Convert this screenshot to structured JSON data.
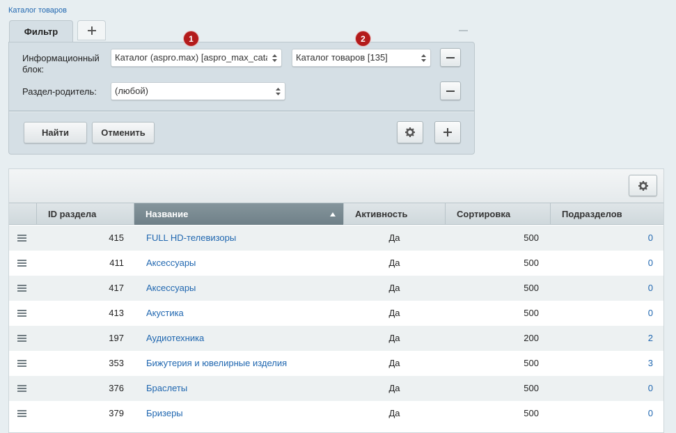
{
  "breadcrumb": "Каталог товаров",
  "filter": {
    "tab_label": "Фильтр",
    "iblock_label": "Информационный блок:",
    "iblock_select": "Каталог (aspro.max) [aspro_max_catalog]",
    "iblock_type_select": "Каталог товаров [135]",
    "section_label": "Раздел-родитель:",
    "section_select": "(любой)",
    "badge1": "1",
    "badge2": "2",
    "find_button": "Найти",
    "cancel_button": "Отменить"
  },
  "grid": {
    "columns": {
      "id": "ID раздела",
      "name": "Название",
      "active": "Активность",
      "sort": "Сортировка",
      "subsections": "Подразделов"
    },
    "rows": [
      {
        "id": "415",
        "name": "FULL HD-телевизоры",
        "active": "Да",
        "sort": "500",
        "subsections": "0"
      },
      {
        "id": "411",
        "name": "Аксессуары",
        "active": "Да",
        "sort": "500",
        "subsections": "0"
      },
      {
        "id": "417",
        "name": "Аксессуары",
        "active": "Да",
        "sort": "500",
        "subsections": "0"
      },
      {
        "id": "413",
        "name": "Акустика",
        "active": "Да",
        "sort": "500",
        "subsections": "0"
      },
      {
        "id": "197",
        "name": "Аудиотехника",
        "active": "Да",
        "sort": "200",
        "subsections": "2"
      },
      {
        "id": "353",
        "name": "Бижутерия и ювелирные изделия",
        "active": "Да",
        "sort": "500",
        "subsections": "3"
      },
      {
        "id": "376",
        "name": "Браслеты",
        "active": "Да",
        "sort": "500",
        "subsections": "0"
      },
      {
        "id": "379",
        "name": "Бризеры",
        "active": "Да",
        "sort": "500",
        "subsections": "0"
      }
    ]
  },
  "colors": {
    "link": "#2067b0",
    "badge": "#b31b1b",
    "sorted_header": "#7a8a91"
  },
  "icons": [
    "plus-icon",
    "minus-icon",
    "gear-icon",
    "drag-handle-icon",
    "sort-asc-icon"
  ]
}
